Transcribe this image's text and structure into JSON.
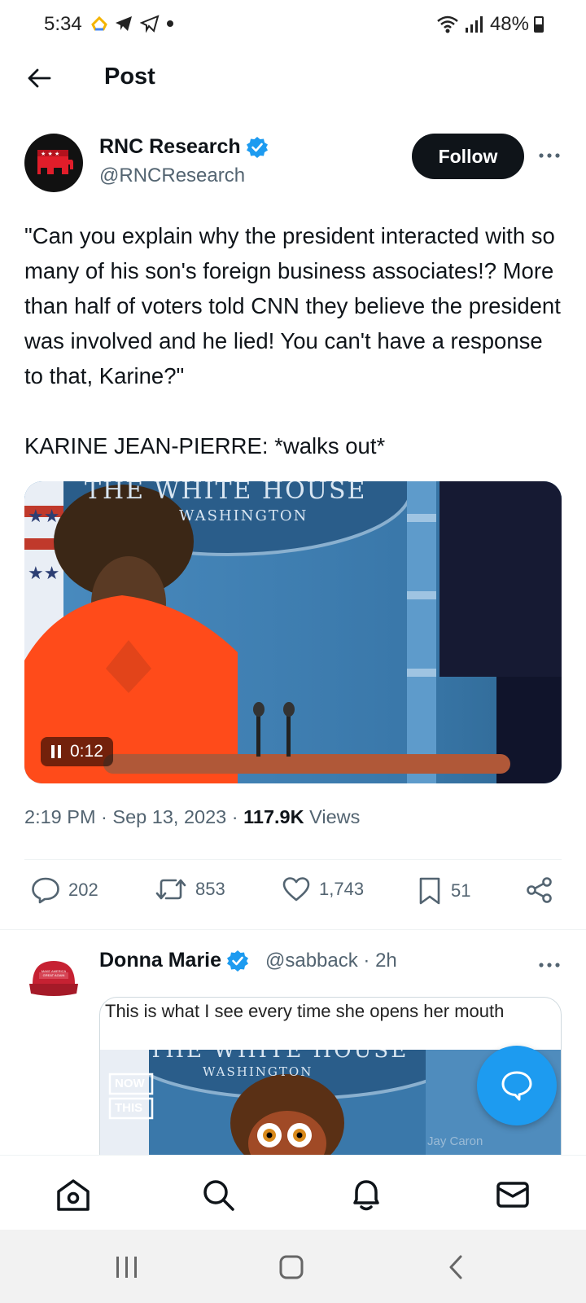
{
  "status_bar": {
    "time": "5:34",
    "battery": "48%"
  },
  "header": {
    "title": "Post"
  },
  "post": {
    "author_name": "RNC Research",
    "author_handle": "@RNCResearch",
    "follow_label": "Follow",
    "text": "\"Can you explain why the president interacted with so many of his son's foreign business associates!? More than half of voters told CNN they believe the president was involved and he lied! You can't have a response to that, Karine?\"\n\nKARINE JEAN-PIERRE: *walks out*",
    "video": {
      "time": "0:12",
      "banner_text": "THE WHITE HOUSE",
      "banner_sub": "WASHINGTON"
    },
    "timestamp": "2:19 PM · Sep 13, 2023 · ",
    "views_count": "117.9K",
    "views_label": " Views",
    "stats": {
      "replies": "202",
      "reposts": "853",
      "likes": "1,743",
      "bookmarks": "51"
    }
  },
  "reply": {
    "author_name": "Donna Marie",
    "author_handle": "@sabback · 2h",
    "caption": "This is what I see every time she opens her mouth",
    "hat_text": "MAKE AMERICA GREAT AGAIN",
    "image_banner": "THE WHITE HOUSE",
    "image_sub": "WASHINGTON",
    "logo_line1": "NOW",
    "logo_line2": "THIS",
    "watermark": "Jay Caron"
  },
  "colors": {
    "accent": "#1d9bf0",
    "text": "#0f1419",
    "secondary": "#536471"
  }
}
